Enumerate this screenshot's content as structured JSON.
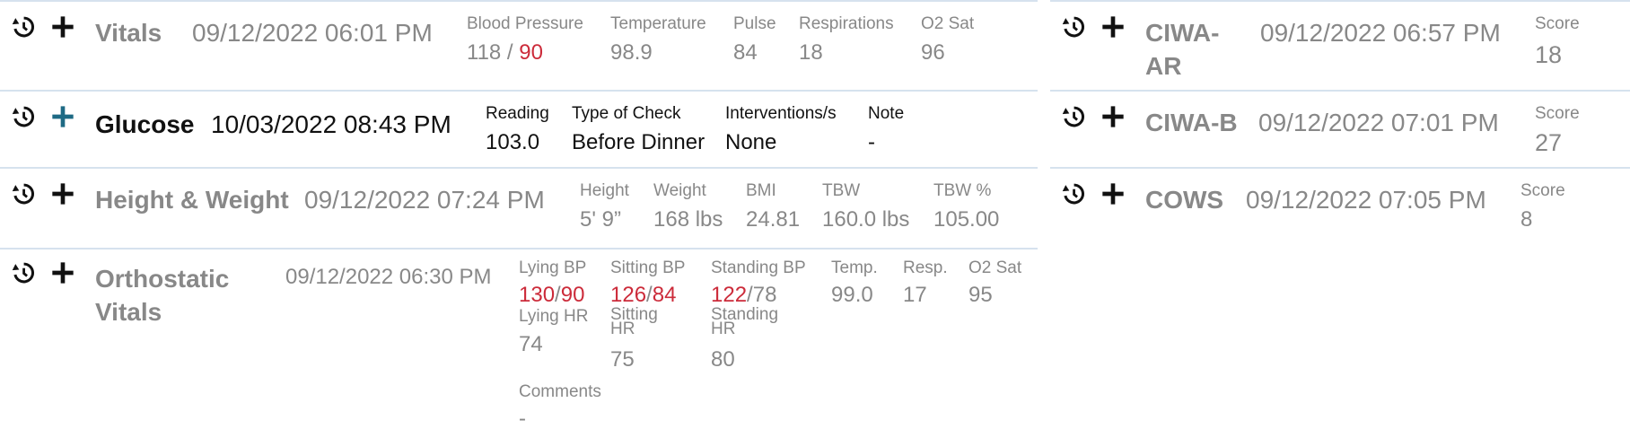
{
  "colors": {
    "muted_text": "#888888",
    "active_text": "#111111",
    "abnormal_value": "#cc2b3a",
    "row_divider": "#d6e2ee",
    "active_add_icon": "#1e6a84"
  },
  "icons": {
    "history": "history-icon",
    "add": "plus-icon"
  },
  "left": {
    "vitals": {
      "title": "Vitals",
      "date": "09/12/2022 06:01 PM",
      "bp_label": "Blood Pressure",
      "bp_sys": "118",
      "bp_sep": " / ",
      "bp_dia": "90",
      "temp_label": "Temperature",
      "temp_value": "98.9",
      "pulse_label": "Pulse",
      "pulse_value": "84",
      "resp_label": "Respirations",
      "resp_value": "18",
      "o2_label": "O2 Sat",
      "o2_value": "96"
    },
    "glucose": {
      "title": "Glucose",
      "date": "10/03/2022 08:43 PM",
      "reading_label": "Reading",
      "reading_value": "103.0",
      "check_label": "Type of Check",
      "check_value": "Before Dinner",
      "interventions_label": "Interventions/s",
      "interventions_value": "None",
      "note_label": "Note",
      "note_value": "-"
    },
    "height_weight": {
      "title": "Height & Weight",
      "date": "09/12/2022 07:24 PM",
      "height_label": "Height",
      "height_value": "5' 9”",
      "weight_label": "Weight",
      "weight_value": "168 lbs",
      "bmi_label": "BMI",
      "bmi_value": "24.81",
      "tbw_label": "TBW",
      "tbw_value": "160.0 lbs",
      "tbwpct_label": "TBW %",
      "tbwpct_value": "105.00"
    },
    "orthostatic": {
      "title_line1": "Orthostatic",
      "title_line2": "Vitals",
      "date": "09/12/2022 06:30 PM",
      "lying_bp_label": "Lying BP",
      "lying_bp_sys": "130",
      "lying_bp_dia": "90",
      "sitting_bp_label": "Sitting BP",
      "sitting_bp_sys": "126",
      "sitting_bp_dia": "84",
      "standing_bp_label": "Standing BP",
      "standing_bp_sys": "122",
      "standing_bp_dia": "78",
      "bp_sep": "/",
      "temp_label": "Temp.",
      "temp_value": "99.0",
      "resp_label": "Resp.",
      "resp_value": "17",
      "o2_label": "O2 Sat",
      "o2_value": "95",
      "lying_hr_label": "Lying HR",
      "lying_hr_value": "74",
      "sitting_hr_label1": "Sitting",
      "sitting_hr_label2": "HR",
      "sitting_hr_value": "75",
      "standing_hr_label1": "Standing",
      "standing_hr_label2": "HR",
      "standing_hr_value": "80",
      "comments_label": "Comments",
      "comments_value": "-"
    }
  },
  "right": {
    "ciwa_ar": {
      "title_line1": "CIWA-",
      "title_line2": "AR",
      "date": "09/12/2022 06:57 PM",
      "score_label": "Score",
      "score_value": "18"
    },
    "ciwa_b": {
      "title": "CIWA-B",
      "date": "09/12/2022 07:01 PM",
      "score_label": "Score",
      "score_value": "27"
    },
    "cows": {
      "title": "COWS",
      "date": "09/12/2022 07:05 PM",
      "score_label": "Score",
      "score_value": "8"
    }
  }
}
